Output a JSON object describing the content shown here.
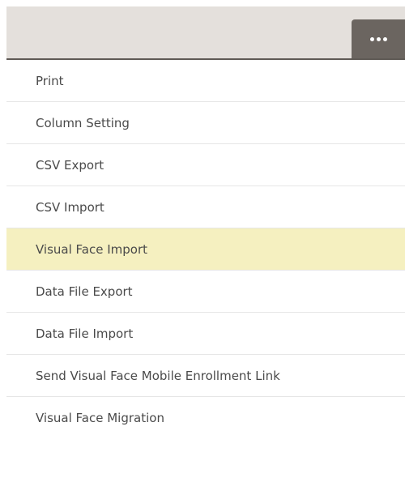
{
  "header": {
    "more_button_icon": "ellipsis-icon"
  },
  "menu": {
    "highlight_color": "#f5f0c0",
    "highlighted_index": 4,
    "items": [
      {
        "label": "Print"
      },
      {
        "label": "Column Setting"
      },
      {
        "label": "CSV Export"
      },
      {
        "label": "CSV Import"
      },
      {
        "label": "Visual Face Import"
      },
      {
        "label": "Data File Export"
      },
      {
        "label": "Data File Import"
      },
      {
        "label": "Send Visual Face Mobile Enrollment Link"
      },
      {
        "label": "Visual Face Migration"
      }
    ]
  }
}
